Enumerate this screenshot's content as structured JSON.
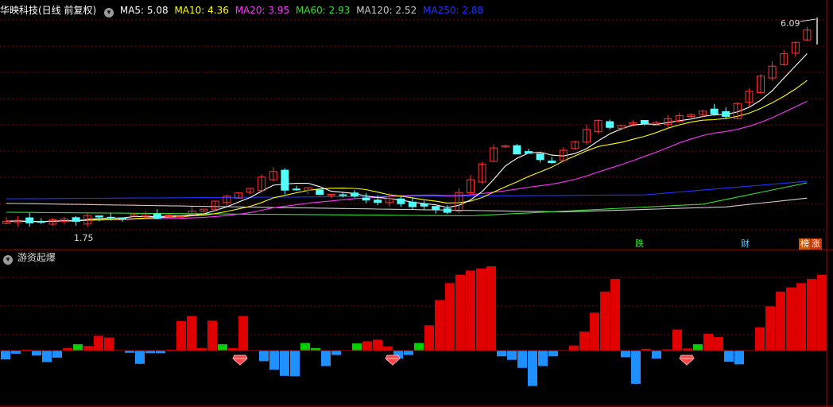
{
  "header": {
    "stock_title": "华映科技(日线 前复权)",
    "indicators": [
      {
        "label": "MA5: 5.08",
        "color": "#ffffff"
      },
      {
        "label": "MA10: 4.36",
        "color": "#ffff00"
      },
      {
        "label": "MA20: 3.95",
        "color": "#ff33ff"
      },
      {
        "label": "MA60: 2.93",
        "color": "#33dd33"
      },
      {
        "label": "MA120: 2.52",
        "color": "#cccccc"
      },
      {
        "label": "MA250: 2.88",
        "color": "#2233ff"
      }
    ]
  },
  "price_labels": {
    "high": "6.09",
    "low": "1.75"
  },
  "signals": {
    "fall": "跌",
    "finance": "财",
    "rank": "榜",
    "rise": "涨"
  },
  "sub_panel": {
    "title": "游资起爆"
  },
  "icons": {
    "collapse": "chevron-down-icon",
    "gem": "gem-icon"
  },
  "colors": {
    "up": "#ff3232",
    "down": "#54ffff",
    "grid": "#8b0000",
    "bar_up": "#e00000",
    "bar_down": "#1e90ff",
    "bar_mid": "#00d000"
  },
  "chart_data": {
    "type": "bar",
    "title": "游资起爆",
    "values": [
      -2,
      -0.7,
      0.2,
      -1.1,
      -2.6,
      -1.6,
      0.6,
      1.5,
      1.1,
      3.5,
      3.1,
      0.1,
      -0.5,
      -3.0,
      -0.6,
      -0.6,
      0.2,
      7.0,
      8.2,
      0.6,
      7.1,
      1.5,
      0.6,
      8.2,
      0.1,
      -2.4,
      -4.3,
      -5.7,
      -5.8,
      1.8,
      0.6,
      -3.5,
      -1.0,
      0.1,
      1.7,
      2.2,
      2.6,
      1.0,
      -1.8,
      -1.0,
      1.8,
      6.0,
      12.0,
      16.0,
      18.0,
      19.0,
      19.5,
      20.0,
      -1.3,
      -2.1,
      -3.9,
      -8.0,
      -3.5,
      -1.3,
      0.1,
      1.2,
      4.5,
      9.0,
      14.0,
      17.0,
      -1.5,
      -7.5,
      0.4,
      -1.8,
      0.3,
      5.0,
      0.5,
      1.5,
      4.0,
      3.2,
      -2.5,
      -3.1,
      0.1,
      5.5,
      10.5,
      14.0,
      15.0,
      16.0,
      17.0,
      18.0
    ],
    "ylim": [
      -12,
      20
    ],
    "gems_at": [
      20,
      33,
      58
    ],
    "candles": {
      "x_count": 70,
      "ma_lines": [
        "MA5",
        "MA10",
        "MA20",
        "MA60",
        "MA120",
        "MA250"
      ]
    }
  }
}
